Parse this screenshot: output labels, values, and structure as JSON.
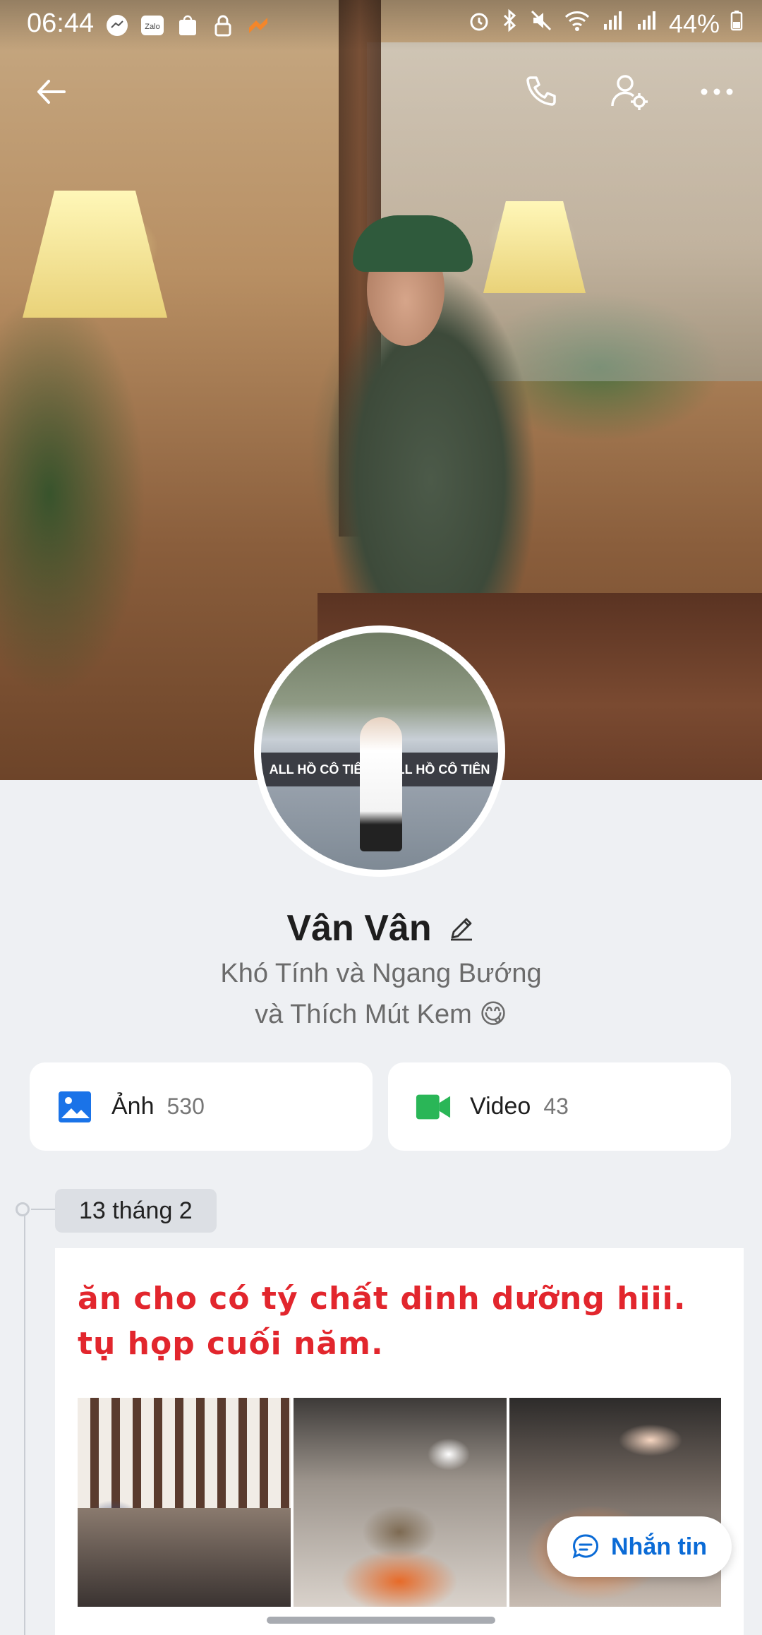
{
  "status_bar": {
    "time": "06:44",
    "battery": "44%",
    "apps": [
      "messenger-icon",
      "zalo-icon",
      "shopee-icon",
      "lock-icon",
      "app-icon"
    ],
    "indicators": [
      "alarm-icon",
      "bluetooth-icon",
      "mute-icon",
      "wifi-icon",
      "signal-icon",
      "signal-icon"
    ]
  },
  "status_apps": {
    "zalo": "Zalo"
  },
  "profile": {
    "name": "Vân Vân",
    "bio_line1": "Khó Tính và Ngang Bướng",
    "bio_line2": "và Thích Mút Kem 😋",
    "avatar_banner_left": "ALL HỒ CÔ TIÊN",
    "avatar_banner_right": "ALL HỒ CÔ TIÊN"
  },
  "media": {
    "photos_label": "Ảnh",
    "photos_count": "530",
    "videos_label": "Video",
    "videos_count": "43"
  },
  "timeline": {
    "date": "13 tháng 2",
    "post_text": "ăn cho có tý chất dinh dưỡng hiii. tụ họp cuối năm."
  },
  "actions": {
    "message_label": "Nhắn tin"
  },
  "colors": {
    "accent": "#0b6bd6",
    "post_text": "#e2262d",
    "photo_icon": "#1a73e8",
    "video_icon": "#2ab657"
  }
}
